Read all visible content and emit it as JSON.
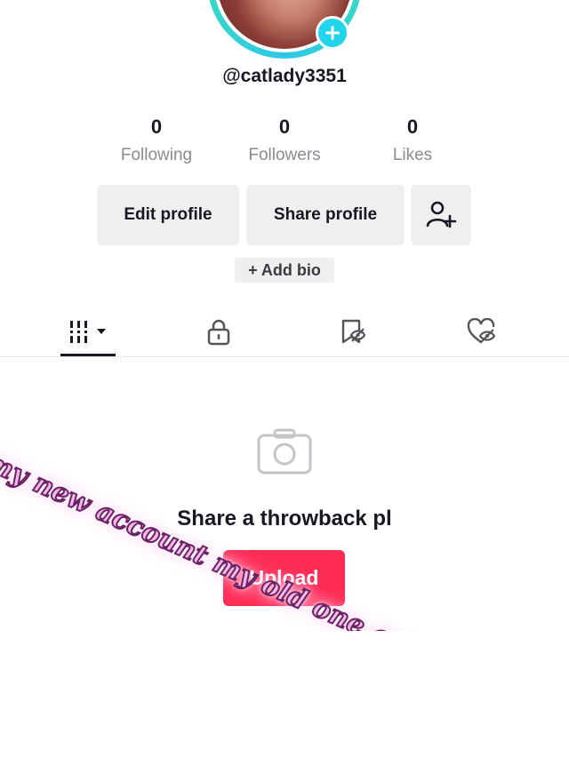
{
  "profile": {
    "username": "@catlady3351"
  },
  "stats": [
    {
      "value": "0",
      "label": "Following"
    },
    {
      "value": "0",
      "label": "Followers"
    },
    {
      "value": "0",
      "label": "Likes"
    }
  ],
  "actions": {
    "edit_profile": "Edit profile",
    "share_profile": "Share profile",
    "add_bio": "+ Add bio"
  },
  "tabs": [
    {
      "icon": "videos-grid-icon",
      "active": true
    },
    {
      "icon": "lock-icon",
      "active": false
    },
    {
      "icon": "favorites-icon",
      "active": false
    },
    {
      "icon": "liked-icon",
      "active": false
    }
  ],
  "empty_state": {
    "message": "Share a throwback pl",
    "upload_label": "Upload"
  },
  "overlay": {
    "text": "my new account my old one got hacked"
  },
  "colors": {
    "accent": "#fe2c55",
    "plus_badge": "#20d5ec",
    "overlay_fill": "#f3b9ea",
    "overlay_outline": "#6b2163"
  }
}
